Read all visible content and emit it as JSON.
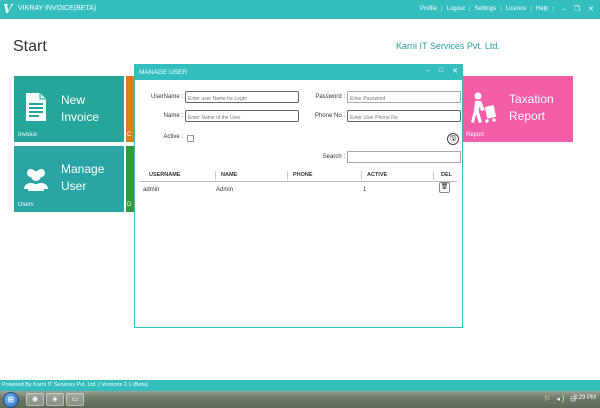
{
  "app": {
    "logo": "V",
    "title": "VIKRAY INVOICE(BETA)"
  },
  "topmenu": {
    "items": [
      "Profile",
      "Logout",
      "Settings",
      "Licence",
      "Help"
    ],
    "separator": "|",
    "minimize": "–",
    "restore": "❐",
    "close": "✕"
  },
  "page": {
    "start": "Start",
    "company": "Karni IT Services Pvt. Ltd."
  },
  "tiles": {
    "invoice": {
      "title_line1": "New",
      "title_line2": "Invoice",
      "label": "Invoice",
      "color": "#26a69a"
    },
    "users": {
      "title_line1": "Manage",
      "title_line2": "User",
      "label": "Users",
      "color": "#2ba4a6"
    },
    "orange": {
      "label": "C",
      "color": "#e07b1d"
    },
    "green": {
      "label": "D",
      "color": "#2f9b3a"
    },
    "report": {
      "title_line1": "Taxation",
      "title_line2": "Report",
      "label": "Report",
      "color": "#f35ca6"
    }
  },
  "dialog": {
    "title": "MANAGE USER",
    "controls": {
      "minimize": "–",
      "maximize": "□",
      "close": "✕"
    },
    "form": {
      "username_label": "UserName :",
      "username_placeholder": "Enter user Name for Login",
      "name_label": "Name :",
      "name_placeholder": "Enter Name of the User",
      "active_label": "Active :",
      "password_label": "Password :",
      "password_placeholder": "Enter Password",
      "phone_label": "Phone No :",
      "phone_placeholder": "Enter User Phone No",
      "search_label": "Search :",
      "save_icon": "🖫"
    },
    "table": {
      "columns": [
        "USERNAME",
        "NAME",
        "PHONE",
        "ACTIVE",
        "DEL"
      ],
      "rows": [
        {
          "username": "admin",
          "name": "Admin",
          "phone": "",
          "active": "1",
          "del_icon": "🗑"
        }
      ]
    }
  },
  "statusbar": {
    "text": "Powered By Karni IT Services Pvt. Ltd. | Versions 2.1 (Beta)"
  },
  "taskbar": {
    "tray": "⚐ ◂) ⊟",
    "clock": "3:29 PM"
  },
  "colors": {
    "accent": "#33bdbd",
    "report_pink": "#f35ca6"
  }
}
